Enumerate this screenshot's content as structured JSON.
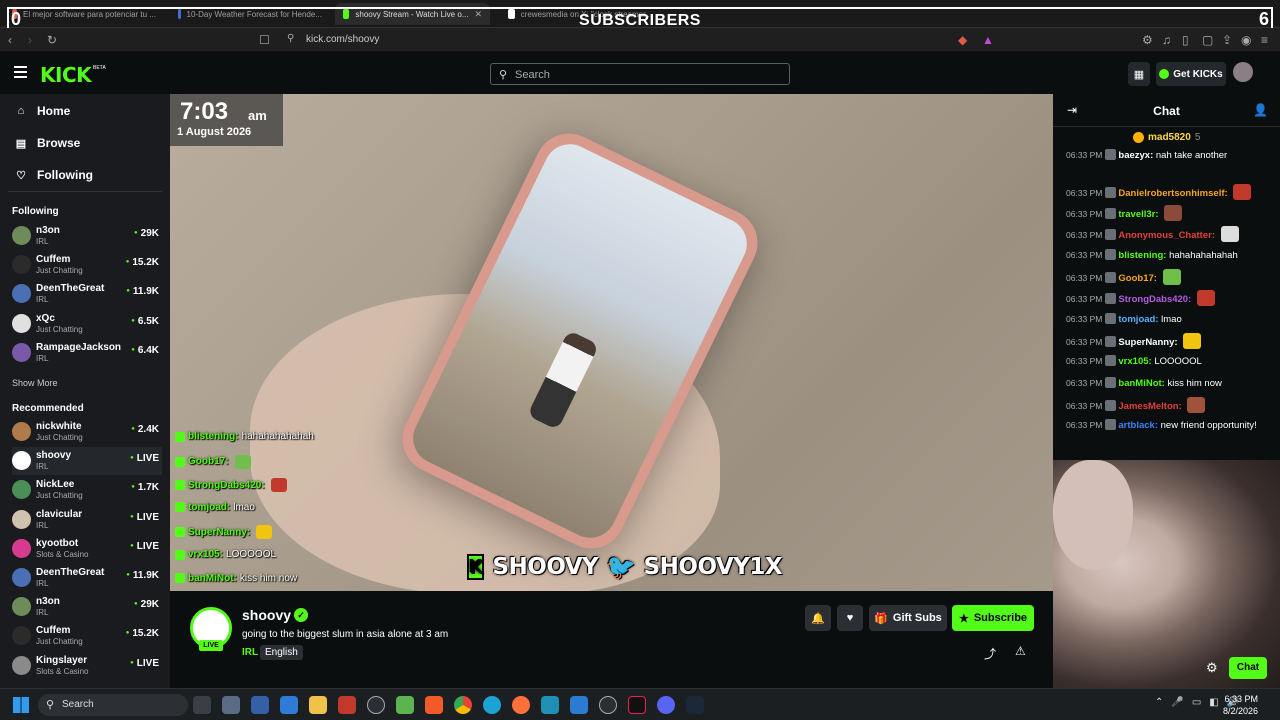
{
  "browser": {
    "tabs": [
      {
        "title": "El mejor software para potenciar tu ...",
        "color": "#e25b45"
      },
      {
        "title": "10-Day Weather Forecast for Hende...",
        "color": "#3b6fd1"
      },
      {
        "title": "shoovy Stream - Watch Live o...",
        "color": "#53fc18",
        "active": true
      },
      {
        "title": "crewesmedia on X: \"clock streamer...",
        "color": "#ffffff"
      }
    ],
    "url": "kick.com/shoovy"
  },
  "overlay": {
    "left_count": "0",
    "title": "SUBSCRIBERS",
    "right_count": "6"
  },
  "header": {
    "logo": "KICK",
    "beta": "BETA",
    "search_placeholder": "Search",
    "get_kicks_label": "Get KICKs"
  },
  "sidebar": {
    "nav": [
      {
        "label": "Home",
        "icon": "home-icon",
        "glyph": "⌂"
      },
      {
        "label": "Browse",
        "icon": "browse-icon",
        "glyph": "▤"
      },
      {
        "label": "Following",
        "icon": "heart-icon",
        "glyph": "♡"
      }
    ],
    "following_title": "Following",
    "following": [
      {
        "name": "n3on",
        "category": "IRL",
        "viewers": "29K",
        "avatar": "#6d8c5a"
      },
      {
        "name": "Cuffem",
        "category": "Just Chatting",
        "viewers": "15.2K",
        "avatar": "#2b2b2b"
      },
      {
        "name": "DeenTheGreat",
        "category": "IRL",
        "viewers": "11.9K",
        "avatar": "#4a6fb5"
      },
      {
        "name": "xQc",
        "category": "Just Chatting",
        "viewers": "6.5K",
        "avatar": "#e0e0e0"
      },
      {
        "name": "RampageJackson",
        "category": "IRL",
        "viewers": "6.4K",
        "avatar": "#7a5aa8"
      }
    ],
    "show_more": "Show More",
    "recommended_title": "Recommended",
    "recommended": [
      {
        "name": "nickwhite",
        "category": "Just Chatting",
        "viewers": "2.4K",
        "avatar": "#b07a4a"
      },
      {
        "name": "shoovy",
        "category": "IRL",
        "viewers": "LIVE",
        "avatar": "#ffffff"
      },
      {
        "name": "NickLee",
        "category": "Just Chatting",
        "viewers": "1.7K",
        "avatar": "#4a8f57"
      },
      {
        "name": "clavicular",
        "category": "IRL",
        "viewers": "LIVE",
        "avatar": "#cfc3b0"
      },
      {
        "name": "kyootbot",
        "category": "Slots & Casino",
        "viewers": "LIVE",
        "avatar": "#d63b8f"
      },
      {
        "name": "DeenTheGreat",
        "category": "IRL",
        "viewers": "11.9K",
        "avatar": "#4a6fb5"
      },
      {
        "name": "n3on",
        "category": "IRL",
        "viewers": "29K",
        "avatar": "#6d8c5a"
      },
      {
        "name": "Cuffem",
        "category": "Just Chatting",
        "viewers": "15.2K",
        "avatar": "#2b2b2b"
      },
      {
        "name": "Kingslayer",
        "category": "Slots & Casino",
        "viewers": "LIVE",
        "avatar": "#8a8a8a"
      }
    ]
  },
  "video": {
    "clock_time": "7:03",
    "clock_ampm": "am",
    "clock_date": "1 August 2026",
    "banner_kick": "SHOOVY",
    "banner_twitter": "SHOOVY1X",
    "overlay_chat": [
      {
        "user": "blistening:",
        "text": "hahahahahahah"
      },
      {
        "user": "Goob17:",
        "text": "",
        "emote": "#6fbf4a"
      },
      {
        "user": "StrongDabs420:",
        "text": "",
        "emote": "#c0392b"
      },
      {
        "user": "tomjoad:",
        "text": "lmao"
      },
      {
        "user": "SuperNanny:",
        "text": "",
        "emote": "#f1c40f"
      },
      {
        "user": "vrx105:",
        "text": "LOOOOOL"
      },
      {
        "user": "banMiNot:",
        "text": "kiss him now"
      }
    ]
  },
  "streamer": {
    "name": "shoovy",
    "live_label": "LIVE",
    "title": "going to the biggest slum in asia alone at 3 am",
    "category": "IRL",
    "language": "English",
    "gift_subs_label": "Gift Subs",
    "subscribe_label": "Subscribe"
  },
  "chat": {
    "title": "Chat",
    "pinned_user": "mad5820",
    "pinned_count": "5",
    "messages": [
      {
        "time": "06:33 PM",
        "user": "baezyx:",
        "color": "#ffffff",
        "text": "nah take another"
      },
      {
        "time": "06:33 PM",
        "user": "Danielrobertsonhimself:",
        "color": "#f5a623",
        "text": "",
        "emote": "#c0392b"
      },
      {
        "time": "06:33 PM",
        "user": "travell3r:",
        "color": "#53fc18",
        "text": "",
        "emote": "#8b4a3a"
      },
      {
        "time": "06:33 PM",
        "user": "Anonymous_Chatter:",
        "color": "#e0413c",
        "text": "",
        "emote": "#dddddd"
      },
      {
        "time": "06:33 PM",
        "user": "blistening:",
        "color": "#53fc18",
        "text": "hahahahahahah"
      },
      {
        "time": "06:33 PM",
        "user": "Goob17:",
        "color": "#f5a623",
        "text": "",
        "emote": "#6fbf4a"
      },
      {
        "time": "06:33 PM",
        "user": "StrongDabs420:",
        "color": "#b45ce0",
        "text": "",
        "emote": "#c0392b"
      },
      {
        "time": "06:33 PM",
        "user": "tomjoad:",
        "color": "#5ab0ff",
        "text": "lmao"
      },
      {
        "time": "06:33 PM",
        "user": "SuperNanny:",
        "color": "#ffffff",
        "text": "",
        "emote": "#f1c40f"
      },
      {
        "time": "06:33 PM",
        "user": "vrx105:",
        "color": "#53fc18",
        "text": "LOOOOOL"
      },
      {
        "time": "06:33 PM",
        "user": "banMiNot:",
        "color": "#53fc18",
        "text": "kiss him now"
      },
      {
        "time": "06:33 PM",
        "user": "JamesMelton:",
        "color": "#e0413c",
        "text": "",
        "emote": "#a0533a"
      },
      {
        "time": "06:33 PM",
        "user": "artblack:",
        "color": "#3b82f6",
        "text": "new friend opportunity!"
      }
    ],
    "chat_button": "Chat"
  },
  "taskbar": {
    "search_placeholder": "Search",
    "time": "6:33 PM",
    "date": "8/2/2026"
  }
}
